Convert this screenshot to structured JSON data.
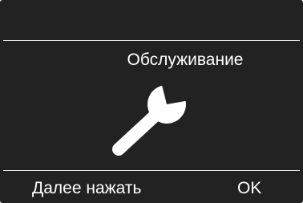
{
  "screen": {
    "title": "Обслуживание",
    "icon": "wrench-icon"
  },
  "softkeys": {
    "left_label": "Далее нажать",
    "right_label": "OK"
  },
  "colors": {
    "background": "#222222",
    "foreground": "#ffffff",
    "divider": "#e6e6e6"
  }
}
